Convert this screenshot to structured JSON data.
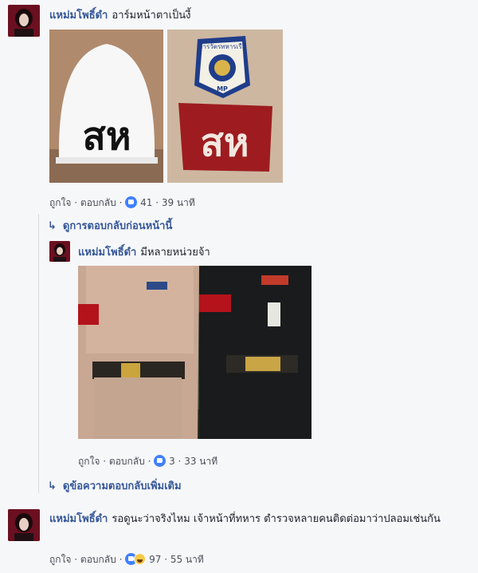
{
  "comment1": {
    "author": "แหม่มโพธิ์ดำ",
    "text": "อาร์มหน้าตาเป็นงี้",
    "helmet_text": "สห",
    "armband_text": "สห",
    "patch_text": "สารวัตรทหารเรือ",
    "patch_mp": "MP",
    "like_label": "ถูกใจ",
    "reply_label": "ตอบกลับ",
    "reaction_count": "41",
    "time": "39 นาที"
  },
  "previous_replies_link": "ดูการตอบกลับก่อนหน้านี้",
  "reply1": {
    "author": "แหม่มโพธิ์ดำ",
    "text": "มีหลายหน่วยจ้า",
    "like_label": "ถูกใจ",
    "reply_label": "ตอบกลับ",
    "reaction_count": "3",
    "time": "33 นาที"
  },
  "more_replies_link": "ดูข้อความตอบกลับเพิ่มเติม",
  "comment2": {
    "author": "แหม่มโพธิ์ดำ",
    "text": "รอดูนะว่าจริงไหม เจ้าหน้าที่ทหาร ตำรวจหลายคนติดต่อมาว่าปลอมเช่นกัน",
    "like_label": "ถูกใจ",
    "reply_label": "ตอบกลับ",
    "reaction_count": "97",
    "time": "55 นาที"
  },
  "separator": "·",
  "reply_arrow": "↳",
  "icons": {
    "like": "like-reaction-icon",
    "haha": "haha-reaction-icon",
    "reply_arrow": "reply-arrow-icon"
  }
}
